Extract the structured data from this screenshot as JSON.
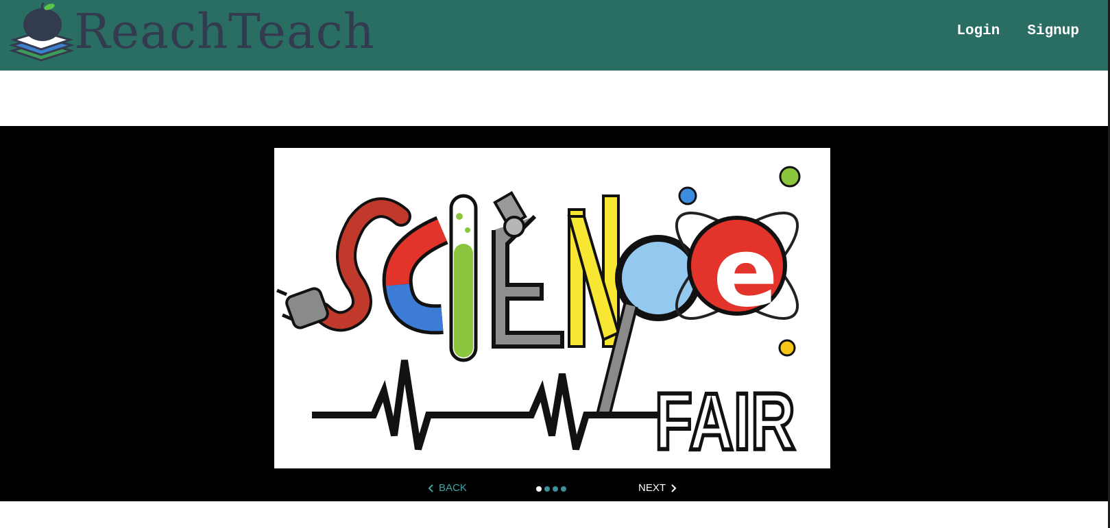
{
  "brand": {
    "name": "ReachTeach"
  },
  "nav": {
    "login": "Login",
    "signup": "Signup"
  },
  "carousel": {
    "slide_text": "FAIR",
    "back_label": "BACK",
    "next_label": "NEXT",
    "active_index": 0,
    "slide_count": 4
  },
  "colors": {
    "navbar": "#2a6e63",
    "brand_text": "#333c4e",
    "back_accent": "#3ea6a6",
    "dot_inactive": "#3e8f9a"
  },
  "icons": {
    "logo": "apple-books-logo-icon",
    "back": "chevron-left-icon",
    "next": "chevron-right-icon"
  }
}
